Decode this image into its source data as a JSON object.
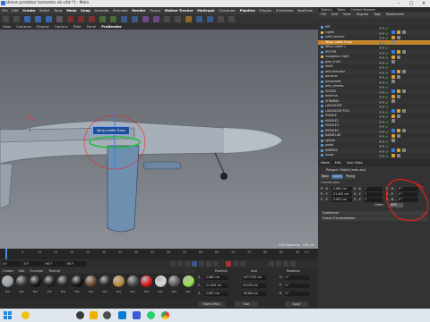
{
  "window": {
    "title": "drone predator tamamlo ok.c4d *] - Main"
  },
  "menubar": {
    "items": [
      "File",
      "Edit",
      "Create",
      "Select",
      "Tools",
      "Mesh",
      "Snap",
      "Animate",
      "Simulate",
      "Render",
      "Sculpt",
      "Motion Tracker",
      "MoGraph",
      "Character",
      "Pipeline",
      "Plugins",
      "X-Particles",
      "RealFlow",
      "Octane",
      "Script",
      "Window",
      "Help"
    ]
  },
  "viewport": {
    "menu": [
      "View",
      "Cameras",
      "Display",
      "Options",
      "Filter",
      "Panel",
      "ProRender"
    ],
    "tooltip": "Wing rudder R.ass",
    "grid_label": "Grid Spacing : 100 cm"
  },
  "timeline": {
    "ticks": [
      "0",
      "5",
      "10",
      "15",
      "20",
      "25",
      "30",
      "35",
      "40",
      "45",
      "50",
      "55",
      "60",
      "65",
      "70",
      "75",
      "80",
      "85",
      "90"
    ],
    "end_label": "0 F"
  },
  "transport": {
    "start": "0 F",
    "current": "0 F",
    "end": "90 F",
    "end2": "90 F"
  },
  "materials": {
    "menu": [
      "Create",
      "Edit",
      "Function",
      "Texture"
    ],
    "items": [
      {
        "label": "Mat",
        "color": "#9aa3ab"
      },
      {
        "label": "Mat",
        "color": "#3b3b3b"
      },
      {
        "label": "Mat",
        "color": "#1a1a1a"
      },
      {
        "label": "Mat",
        "color": "#222222"
      },
      {
        "label": "Mat",
        "color": "#2b2b2b"
      },
      {
        "label": "Mat",
        "color": "#161616"
      },
      {
        "label": "Mat",
        "color": "#6b4a2a"
      },
      {
        "label": "Mat",
        "color": "#2a2a2a"
      },
      {
        "label": "Mat",
        "color": "#c08a3a"
      },
      {
        "label": "Mat",
        "color": "#4a4a4a"
      },
      {
        "label": "Mat",
        "color": "#e01a1a"
      },
      {
        "label": "Mat",
        "color": "#dddddd"
      },
      {
        "label": "Mat",
        "color": "#5a5a5a"
      },
      {
        "label": "Mat",
        "color": "#9be34a"
      }
    ]
  },
  "coordinates": {
    "headers": [
      "Position",
      "Size",
      "Rotation"
    ],
    "rows": [
      {
        "axis": "X",
        "pos": "-2.882 cm",
        "size": "1477.575 cm",
        "rot": "0 °",
        "rlabel": "H"
      },
      {
        "axis": "Y",
        "pos": "-21.405 cm",
        "size": "43.032 cm",
        "rot": "0 °",
        "rlabel": "P"
      },
      {
        "axis": "Z",
        "pos": "-2.897 cm",
        "size": "78.084 cm",
        "rot": "0 °",
        "rlabel": "B"
      }
    ],
    "mode": "Object (Rel)",
    "size_mode": "Size",
    "apply": "Apply"
  },
  "object_manager": {
    "tabs": [
      "Objects",
      "Takes",
      "Content Browser"
    ],
    "menu": [
      "File",
      "Edit",
      "View",
      "Objects",
      "Tags",
      "Bookmarks"
    ],
    "rows": [
      {
        "name": "HIP",
        "icon": "#5aa0e0",
        "sel": false
      },
      {
        "name": "Lights",
        "icon": "#e0c05a",
        "sel": false
      },
      {
        "name": "nadil kamera",
        "icon": "#5aa0e0",
        "sel": false
      },
      {
        "name": "Wing rudder R.ass",
        "icon": "#e08a3a",
        "sel": true
      },
      {
        "name": "Wing rudder L",
        "icon": "#5aa0e0",
        "sel": false
      },
      {
        "name": "MOTOR",
        "icon": "#5aa0e0",
        "sel": false
      },
      {
        "name": "navigation Light",
        "icon": "#e0c05a",
        "sel": false
      },
      {
        "name": "gear_front",
        "icon": "#5aa0e0",
        "sel": false
      },
      {
        "name": "lastik",
        "icon": "#5aa0e0",
        "sel": false
      },
      {
        "name": "arka aktuator",
        "icon": "#5aa0e0",
        "sel": false
      },
      {
        "name": "pervane",
        "icon": "#5aa0e0",
        "sel": false
      },
      {
        "name": "pervaneler",
        "icon": "#5aa0e0",
        "sel": false
      },
      {
        "name": "arka_dirseks",
        "icon": "#5aa0e0",
        "sel": false
      },
      {
        "name": "GOVDE",
        "icon": "#5aa0e0",
        "sel": false
      },
      {
        "name": "antenna",
        "icon": "#5aa0e0",
        "sel": false
      },
      {
        "name": "ISTANBUL",
        "icon": "#5aa0e0",
        "sel": false
      },
      {
        "name": "LANCADOR",
        "icon": "#5aa0e0",
        "sel": false
      },
      {
        "name": "LANCADOR FOG",
        "icon": "#5aa0e0",
        "sel": false
      },
      {
        "name": "MISSILE",
        "icon": "#5aa0e0",
        "sel": false
      },
      {
        "name": "MISSILE2",
        "icon": "#5aa0e0",
        "sel": false
      },
      {
        "name": "MISSILE3",
        "icon": "#5aa0e0",
        "sel": false
      },
      {
        "name": "MISSILE4",
        "icon": "#5aa0e0",
        "sel": false
      },
      {
        "name": "KANATLAR",
        "icon": "#5aa0e0",
        "sel": false
      },
      {
        "name": "sphere",
        "icon": "#5aa0e0",
        "sel": false
      },
      {
        "name": "pedal",
        "icon": "#5aa0e0",
        "sel": false
      },
      {
        "name": "KAMERA",
        "icon": "#5aa0e0",
        "sel": false
      },
      {
        "name": "kanat",
        "icon": "#5aa0e0",
        "sel": false
      }
    ]
  },
  "attributes": {
    "tabs": [
      "Mode",
      "Edit",
      "User Data"
    ],
    "heading": "Polygon Object [new ass]",
    "subtabs": [
      "Basic",
      "Coord.",
      "Phong"
    ],
    "section": "Coordinates",
    "rows": [
      {
        "label": "P . X",
        "val": "-2.882 cm",
        "slabel": "S . X",
        "sval": "1",
        "rlabel": "R . H",
        "rval": "0 °"
      },
      {
        "label": "P . Y",
        "val": "-21.405 cm",
        "slabel": "S . Y",
        "sval": "1",
        "rlabel": "R . P",
        "rval": "0 °"
      },
      {
        "label": "P . Z",
        "val": "-2.897 cm",
        "slabel": "S . Z",
        "sval": "1",
        "rlabel": "R . B",
        "rval": "0 °"
      }
    ],
    "order_label": "Order",
    "order_value": "HPB",
    "quaternion": "Quaternion",
    "freeze": "Freeze Transformation"
  },
  "colors": {
    "accent": "#4a8ae0",
    "selected_row": "#c4862a",
    "annotation": "#e02020"
  }
}
